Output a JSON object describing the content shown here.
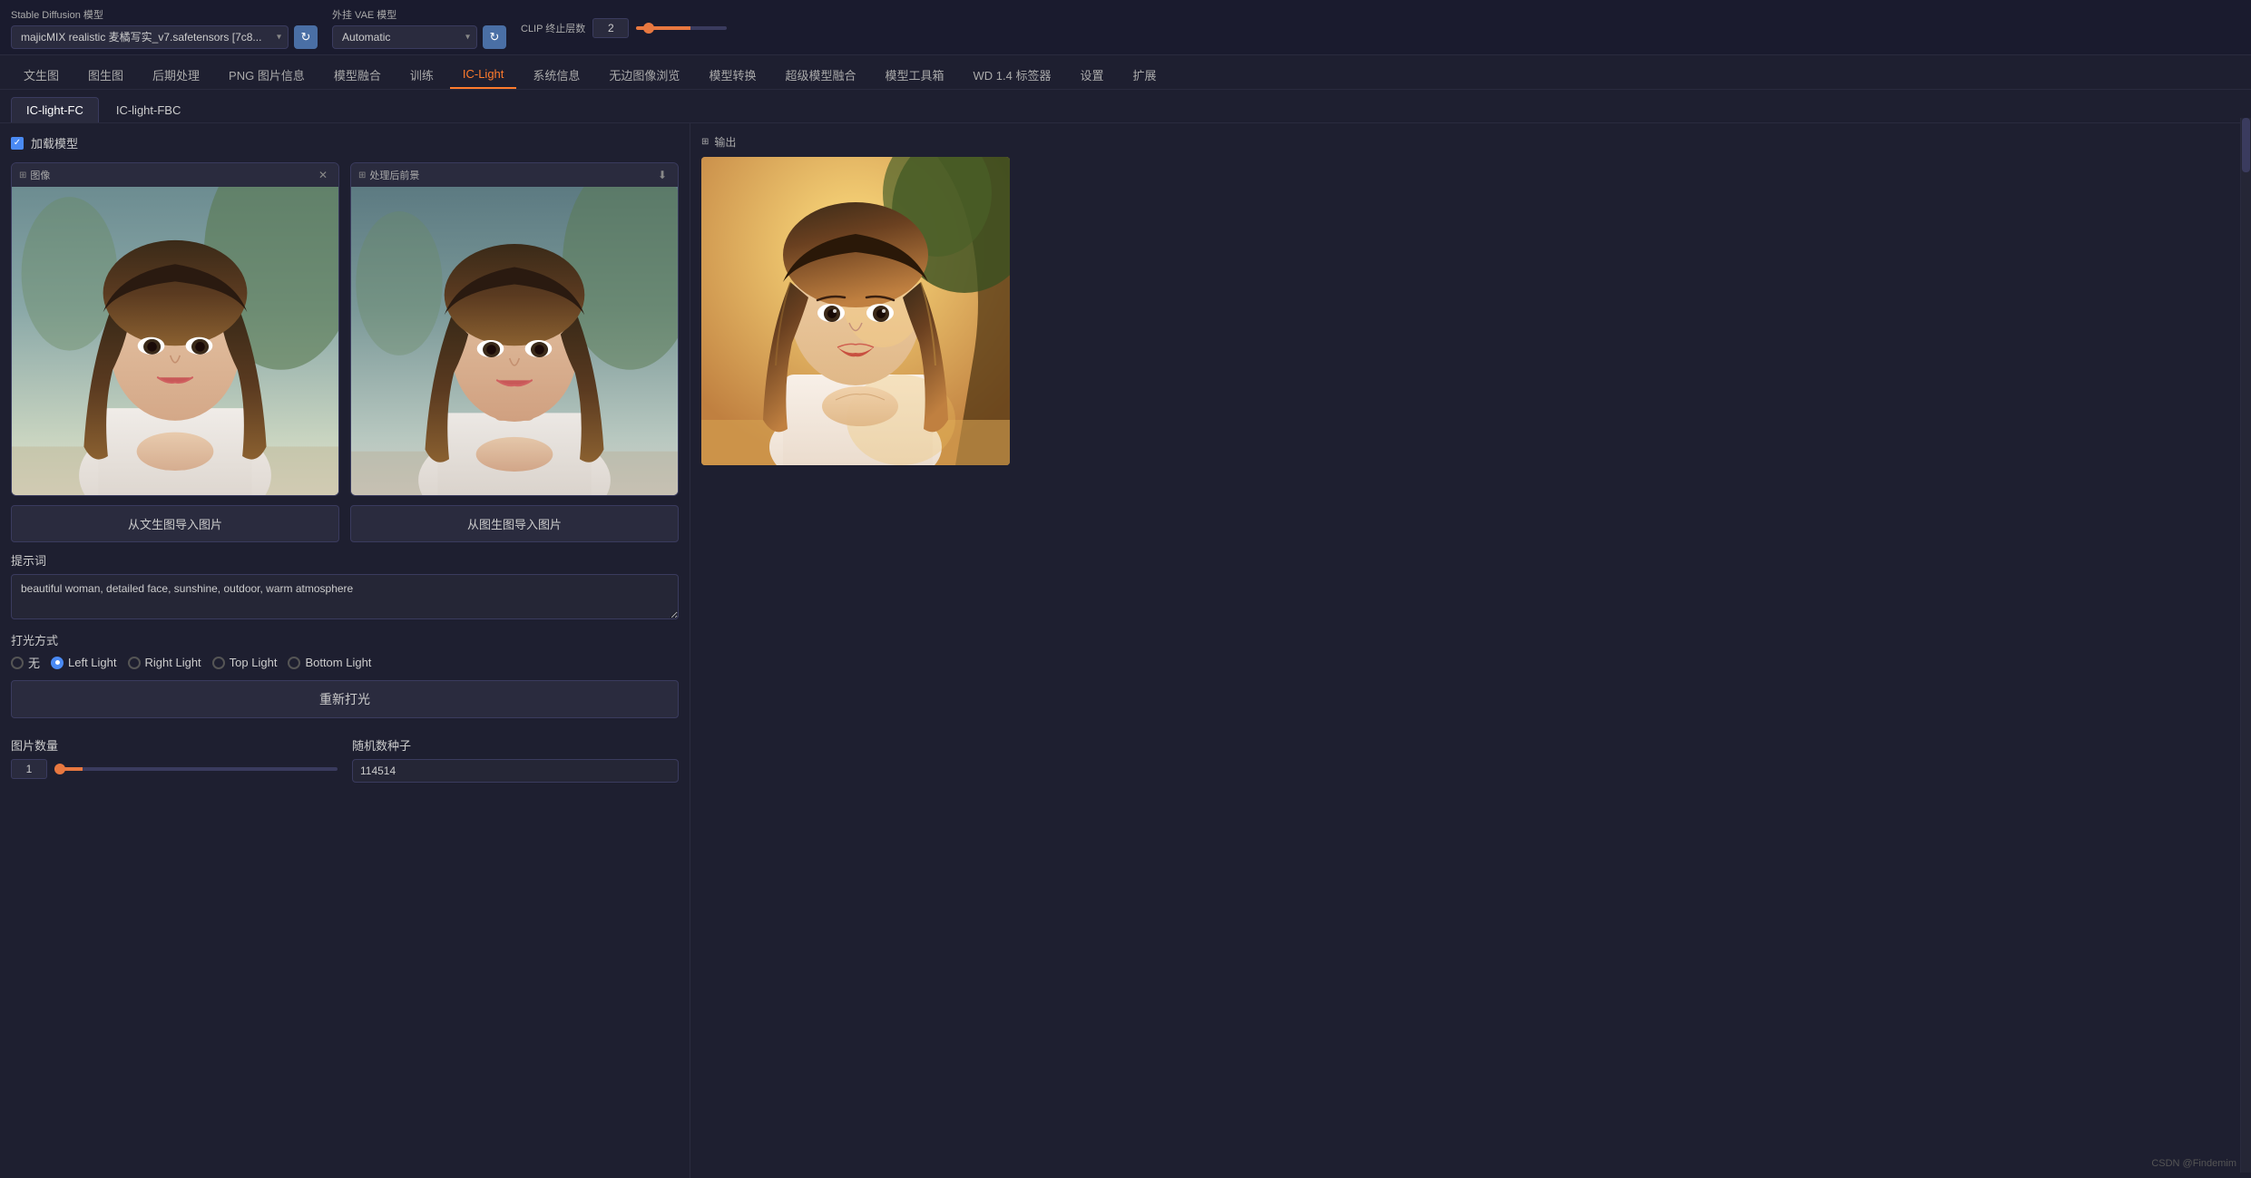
{
  "topBar": {
    "sdModelLabel": "Stable Diffusion 模型",
    "vaeModelLabel": "外挂 VAE 模型",
    "clipLabel": "CLIP 终止层数",
    "clipValue": "2",
    "sdModelValue": "majicMIX realistic 麦橘写实_v7.safetensors [7c8...",
    "vaeModelValue": "Automatic",
    "refreshIcon": "↻",
    "settingsIcon": "⚙"
  },
  "navTabs": [
    {
      "label": "文生图",
      "active": false
    },
    {
      "label": "图生图",
      "active": false
    },
    {
      "label": "后期处理",
      "active": false
    },
    {
      "label": "PNG 图片信息",
      "active": false
    },
    {
      "label": "模型融合",
      "active": false
    },
    {
      "label": "训练",
      "active": false
    },
    {
      "label": "IC-Light",
      "active": true
    },
    {
      "label": "系统信息",
      "active": false
    },
    {
      "label": "无边图像浏览",
      "active": false
    },
    {
      "label": "模型转换",
      "active": false
    },
    {
      "label": "超级模型融合",
      "active": false
    },
    {
      "label": "模型工具箱",
      "active": false
    },
    {
      "label": "WD 1.4 标签器",
      "active": false
    },
    {
      "label": "设置",
      "active": false
    },
    {
      "label": "扩展",
      "active": false
    }
  ],
  "subTabs": [
    {
      "label": "IC-light-FC",
      "active": true
    },
    {
      "label": "IC-light-FBC",
      "active": false
    }
  ],
  "loadModel": {
    "checkboxChecked": true,
    "label": "加载模型"
  },
  "imagePanel1": {
    "label": "图像",
    "closeIcon": "✕"
  },
  "imagePanel2": {
    "label": "处理后前景",
    "downloadIcon": "⬇"
  },
  "importBtn1": "从文生图导入图片",
  "importBtn2": "从图生图导入图片",
  "promptSection": {
    "label": "提示词",
    "value": "beautiful woman, detailed face, sunshine, outdoor, warm atmosphere"
  },
  "lightingSection": {
    "label": "打光方式",
    "options": [
      {
        "label": "无",
        "value": "none",
        "selected": false
      },
      {
        "label": "Left Light",
        "value": "left",
        "selected": true
      },
      {
        "label": "Right Light",
        "value": "right",
        "selected": false
      },
      {
        "label": "Top Light",
        "value": "top",
        "selected": false
      },
      {
        "label": "Bottom Light",
        "value": "bottom",
        "selected": false
      }
    ]
  },
  "relightBtn": "重新打光",
  "countSection": {
    "label": "图片数量",
    "value": "1",
    "sliderMin": 1,
    "sliderMax": 8
  },
  "seedSection": {
    "label": "随机数种子",
    "value": "114514"
  },
  "outputPanel": {
    "headerIcon": "⬛",
    "headerLabel": "输出"
  },
  "watermark": "CSDN @Findemim"
}
